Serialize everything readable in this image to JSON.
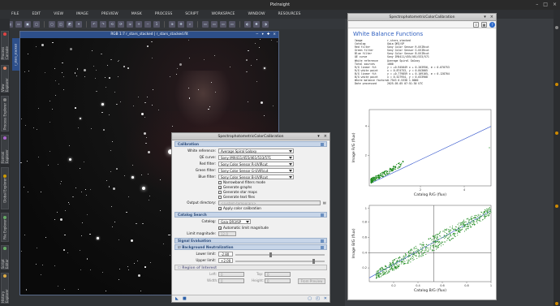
{
  "app": {
    "title": "PixInsight"
  },
  "menu": [
    "FILE",
    "EDIT",
    "VIEW",
    "IMAGE",
    "PREVIEW",
    "MASK",
    "PROCESS",
    "SCRIPT",
    "WORKSPACE",
    "WINDOW",
    "RESOURCES"
  ],
  "left_tabs": [
    "Process Console",
    "View Explorer",
    "Process Explorer",
    "Format Explorer",
    "Global Explorer",
    "File Explorer",
    "Script Editor",
    "History Explorer"
  ],
  "image_window": {
    "title": "RGB 1:7 r_stars_stacked | r_stars_stacked.fit",
    "side_tab": "r_stars_stacked"
  },
  "spcc_dialog": {
    "title": "SpectrophotometricColorCalibration",
    "sections": {
      "calibration": "Calibration",
      "catalog_search": "Catalog Search",
      "signal_evaluation": "Signal Evaluation",
      "background_neutralization": "Background Neutralization",
      "region_of_interest": "Region of Interest"
    },
    "white_reference": {
      "label": "White reference:",
      "value": "Average Spiral Galaxy"
    },
    "qe_curve": {
      "label": "QE curve:",
      "value": "Sony IMX411/455/461/533/571"
    },
    "red_filter": {
      "label": "Red filter:",
      "value": "Sony Color Sensor R-UVIRcut"
    },
    "green_filter": {
      "label": "Green filter:",
      "value": "Sony Color Sensor G-UVIRcut"
    },
    "blue_filter": {
      "label": "Blue filter:",
      "value": "Sony Color Sensor B-UVIRcut"
    },
    "checks": [
      {
        "label": "Narrowband filters mode",
        "checked": false
      },
      {
        "label": "Generate graphs",
        "checked": true
      },
      {
        "label": "Generate star maps",
        "checked": false
      },
      {
        "label": "Generate text files",
        "checked": false
      }
    ],
    "output_directory": {
      "label": "Output directory:",
      "placeholder": "<system-temporary>"
    },
    "apply_color_calibration": "Apply color calibration",
    "catalog": {
      "label": "Catalog:",
      "value": "Gaia DR3/SP"
    },
    "auto_limit_magnitude": "Automatic limit magnitude",
    "limit_magnitude": {
      "label": "Limit magnitude:",
      "value": "12.0"
    },
    "lower_limit": {
      "label": "Lower limit:",
      "value": "-2.80"
    },
    "upper_limit": {
      "label": "Upper limit:",
      "value": "+2.00"
    },
    "roi": {
      "left": "Left:",
      "top": "Top:",
      "width": "Width:",
      "height": "Height:",
      "from_preview": "From Preview",
      "left_val": "0",
      "top_val": "0",
      "width_val": "0",
      "height_val": "0"
    }
  },
  "wb_window": {
    "title": "SpectrophotometricColorCalibration",
    "heading": "White Balance Functions",
    "info": [
      [
        "Image",
        "r_stars_stacked"
      ],
      [
        "Catalog",
        "Gaia DR3/SP"
      ],
      [
        "Red filter",
        "Sony Color Sensor R-UVIRcut"
      ],
      [
        "Green filter",
        "Sony Color Sensor G-UVIRcut"
      ],
      [
        "Blue filter",
        "Sony Color Sensor B-UVIRcut"
      ],
      [
        "QE curve",
        "Sony IMX411/455/461/533/571"
      ],
      [
        "White reference",
        "Average Spiral Galaxy"
      ],
      [
        "Total sources",
        "1000"
      ],
      [
        "R/G linear fit",
        "y = +0.945049 x + 0.203956, σ = 0.070753"
      ],
      [
        "R/G white point",
        "x = 0.874753, y = 0.843005"
      ],
      [
        "B/G linear fit",
        "y = +0.779859 x + 0.109105, σ = 0.128704"
      ],
      [
        "B/G white point",
        "x = 0.527954, y = 0.633908"
      ],
      [
        "White balance factors",
        "0.7543 0.5338 1.0000"
      ],
      [
        "Date processed",
        "2025-05-05 07:51:30 UTC"
      ]
    ],
    "chart1": {
      "xlabel": "Catalog R/G (flux)",
      "ylabel": "Image R/G (flux)",
      "xticks": [
        "2",
        "4"
      ],
      "yticks": [
        "4",
        "2"
      ]
    },
    "chart2": {
      "xlabel": "Catalog B/G (flux)",
      "ylabel": "Image B/G (flux)",
      "xticks": [
        "0.2",
        "0.4",
        "0.6",
        "0.8",
        "1"
      ],
      "yticks": [
        "1",
        "0.8",
        "0.6",
        "0.4",
        "0.2"
      ]
    }
  }
}
